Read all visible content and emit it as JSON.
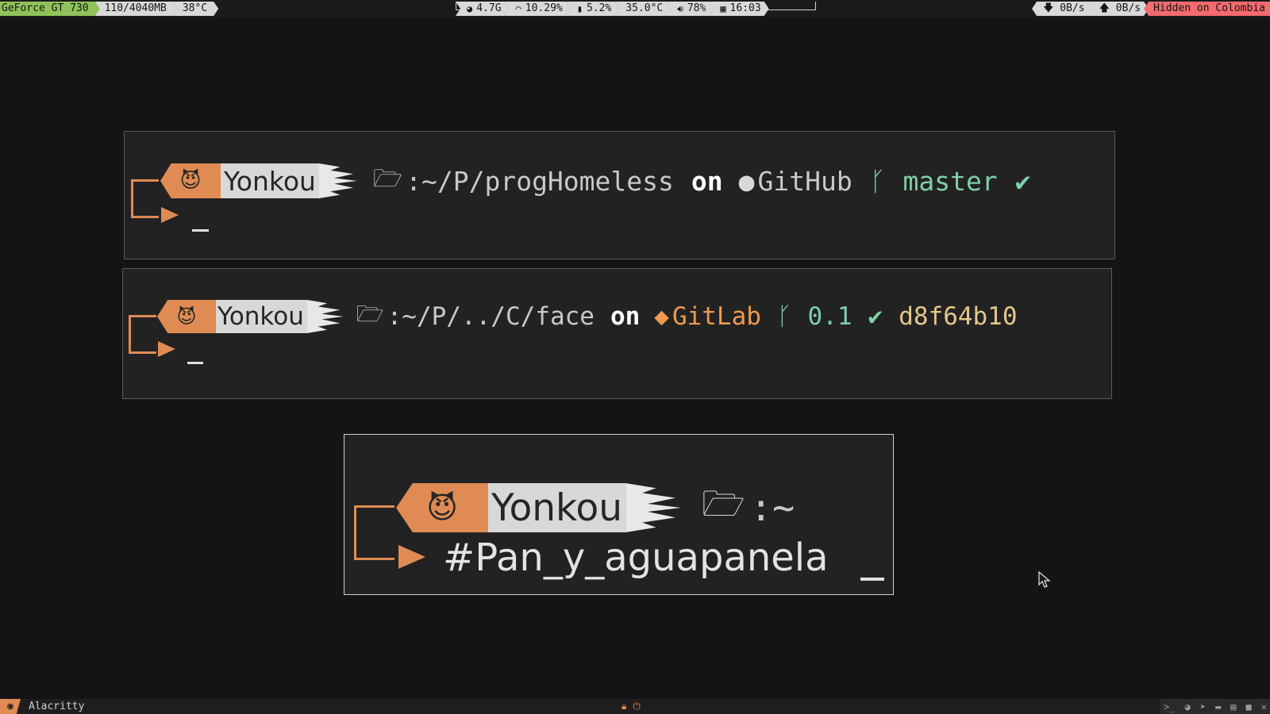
{
  "topbar": {
    "gpu_name": "GeForce GT 730",
    "gpu_mem": "110/4040MB",
    "gpu_temp": "38°C",
    "stats": [
      {
        "icon": "disk-icon",
        "value": "4.7G"
      },
      {
        "icon": "gauge-icon",
        "value": "10.29%"
      },
      {
        "icon": "memory-icon",
        "value": "5.2%"
      },
      {
        "icon": "temperature",
        "value": "35.0°C"
      },
      {
        "icon": "volume-icon",
        "value": "78%"
      },
      {
        "icon": "calendar-icon",
        "value": "16:03"
      }
    ],
    "net_down": "0B/s",
    "net_up": "0B/s",
    "vpn_status": "Hidden on Colombia"
  },
  "terminal1": {
    "user": "Yonkou",
    "path": ":~/P/progHomeless",
    "on": "on",
    "remote": "GitHub",
    "branch": "master",
    "status": "✔"
  },
  "terminal2": {
    "user": "Yonkou",
    "path": ":~/P/../C/face",
    "on": "on",
    "remote": "GitLab",
    "branch": "0.1",
    "status": "✔",
    "commit": "d8f64b10"
  },
  "terminal3": {
    "user": "Yonkou",
    "path": ":~",
    "command": "#Pan_y_aguapanela"
  },
  "bottombar": {
    "app_name": "Alacritty"
  },
  "colors": {
    "accent": "#df8b53",
    "gpu_green": "#8fc35a",
    "vpn_red": "#f36a6f",
    "branch_green": "#7fcfa6",
    "hash_yellow": "#e4c78a"
  }
}
